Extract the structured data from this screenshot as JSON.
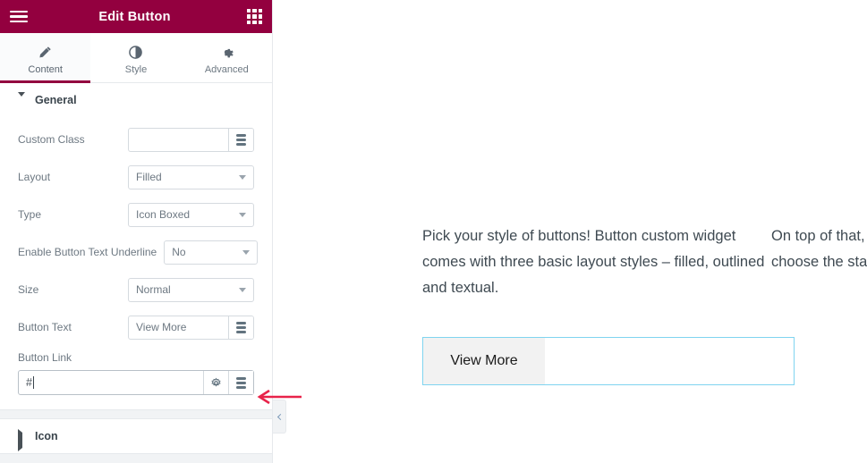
{
  "panel": {
    "header": {
      "title": "Edit Button",
      "menu_icon": "hamburger-icon",
      "widgets_icon": "grid-icon"
    },
    "tabs": [
      {
        "label": "Content",
        "icon": "pencil-icon",
        "active": true
      },
      {
        "label": "Style",
        "icon": "contrast-icon",
        "active": false
      },
      {
        "label": "Advanced",
        "icon": "gear-icon",
        "active": false
      }
    ],
    "sections": [
      {
        "title": "General",
        "expanded": true,
        "fields": [
          {
            "label": "Custom Class",
            "type": "text",
            "value": "",
            "placeholder": "",
            "addon": "dynamic-icon"
          },
          {
            "label": "Layout",
            "type": "select",
            "value": "Filled"
          },
          {
            "label": "Type",
            "type": "select",
            "value": "Icon Boxed"
          },
          {
            "label": "Enable Button Text Underline",
            "type": "select",
            "value": "No"
          },
          {
            "label": "Size",
            "type": "select",
            "value": "Normal"
          },
          {
            "label": "Button Text",
            "type": "text",
            "value": "View More",
            "placeholder": "",
            "addon": "dynamic-icon"
          },
          {
            "label": "Button Link",
            "type": "link",
            "value": "#",
            "placeholder": "",
            "addons": [
              "gear-icon",
              "dynamic-icon"
            ]
          }
        ]
      },
      {
        "title": "Icon",
        "expanded": false,
        "fields": []
      }
    ],
    "collapse_handle": "chevron-left-icon"
  },
  "canvas": {
    "columns": [
      {
        "text": "Pick your style of buttons! Button custom widget comes with three basic layout styles – filled, outlined and textual."
      },
      {
        "text": "On top of that, you also get to choose the standard"
      }
    ],
    "selected_widget": {
      "button_label": "View More"
    }
  },
  "annotation": {
    "arrow": "left-arrow-annotation",
    "color": "#e8234a"
  },
  "colors": {
    "header_bg": "#93003f",
    "accent": "#93003f",
    "selection_border": "#7fd4f0",
    "button_fill": "#f2f2f2",
    "annotation": "#e8234a"
  }
}
